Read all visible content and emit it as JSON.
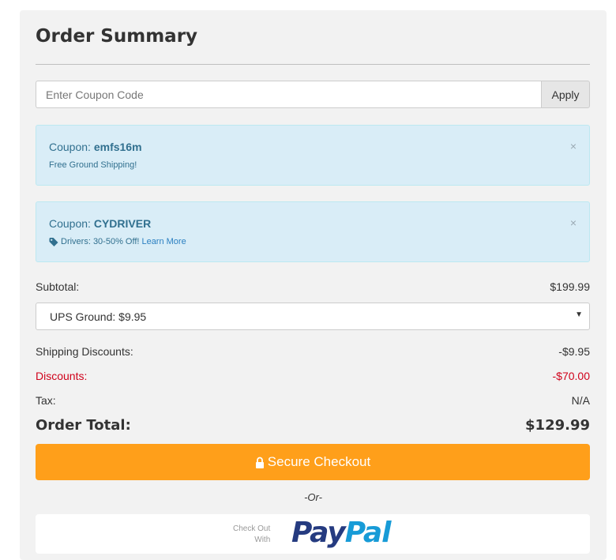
{
  "title": "Order Summary",
  "coupon_form": {
    "placeholder": "Enter Coupon Code",
    "apply_label": "Apply"
  },
  "coupons": [
    {
      "prefix": "Coupon:",
      "code": "emfs16m",
      "description": "Free Ground Shipping!",
      "link": "",
      "close": "×"
    },
    {
      "prefix": "Coupon:",
      "code": "CYDRIVER",
      "description": "Drivers: 30-50% Off!",
      "link": "Learn More",
      "close": "×"
    }
  ],
  "summary": {
    "subtotal_label": "Subtotal:",
    "subtotal_value": "$199.99",
    "shipping_selected": "UPS Ground: $9.95",
    "shipping_discounts_label": "Shipping Discounts:",
    "shipping_discounts_value": "-$9.95",
    "discounts_label": "Discounts:",
    "discounts_value": "-$70.00",
    "tax_label": "Tax:",
    "tax_value": "N/A",
    "total_label": "Order Total:",
    "total_value": "$129.99"
  },
  "checkout": {
    "button_label": "Secure Checkout",
    "or_text": "-Or-",
    "paypal_line1": "Check Out",
    "paypal_line2": "With",
    "paypal_pay": "Pay",
    "paypal_pal": "Pal"
  },
  "colors": {
    "accent": "#ff9f1a",
    "alert_bg": "#d9edf7",
    "discount_red": "#d0021b",
    "paypal_dark": "#253b80",
    "paypal_light": "#179bd7"
  },
  "icons": {
    "tag": "tag-icon",
    "lock": "lock-icon",
    "close": "close-icon",
    "caret": "chevron-down-icon"
  }
}
